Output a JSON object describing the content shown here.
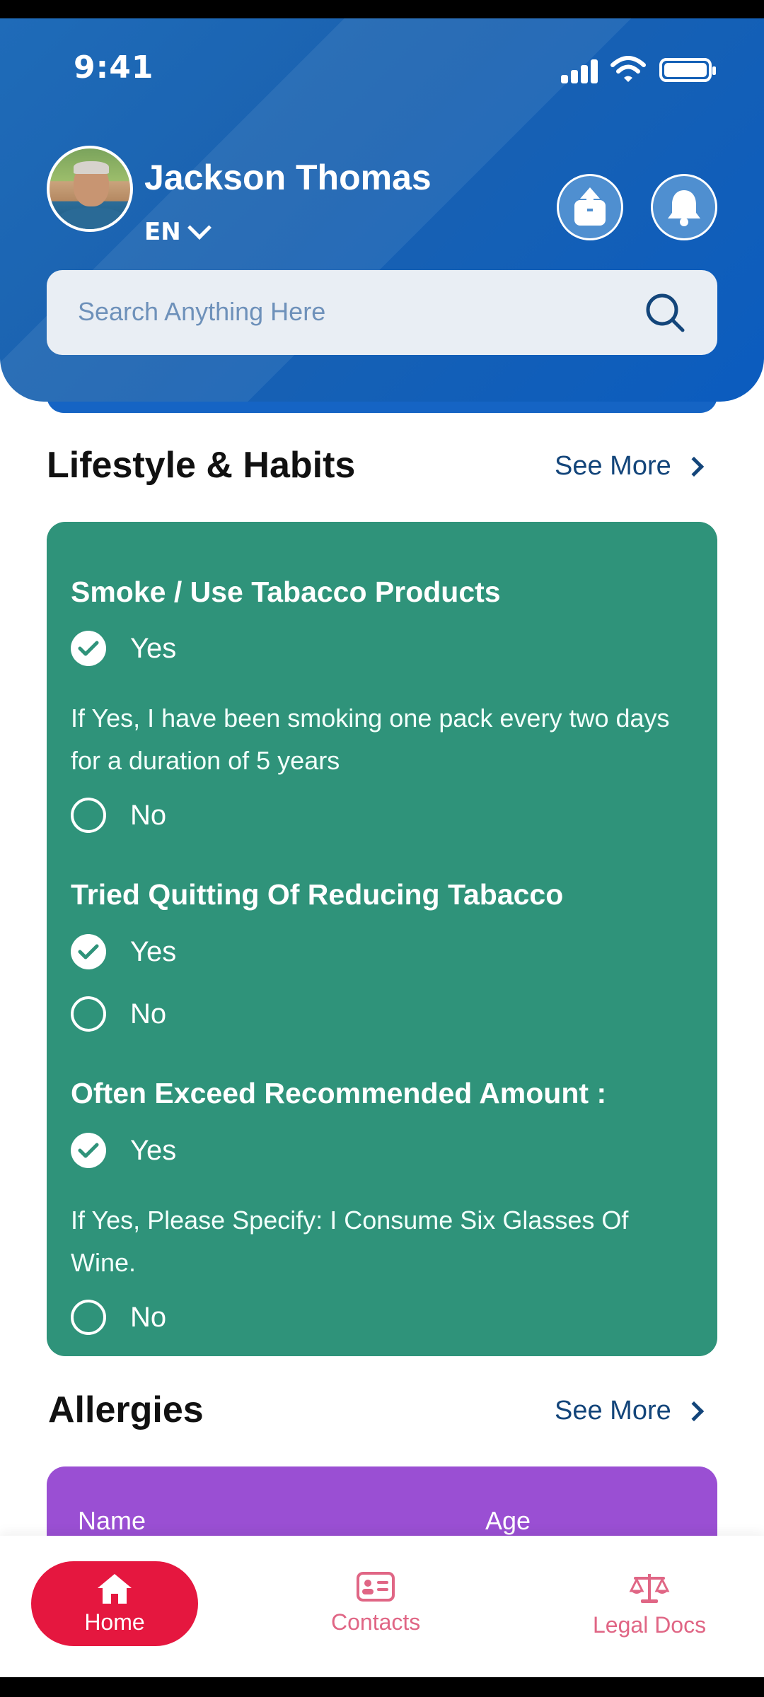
{
  "status_bar": {
    "time": "9:41"
  },
  "header": {
    "user_name": "Jackson Thomas",
    "language": "EN",
    "share_icon": "share-upload-icon",
    "bell_icon": "bell-icon"
  },
  "search": {
    "placeholder": "Search Anything Here"
  },
  "lifestyle": {
    "title": "Lifestyle & Habits",
    "see_more": "See More",
    "q1": {
      "question": "Smoke / Use Tabacco Products",
      "yes": "Yes",
      "note": "If Yes, I have been smoking one pack every two days for a duration of 5 years",
      "no": "No",
      "selected": "Yes"
    },
    "q2": {
      "question": "Tried Quitting Of Reducing Tabacco",
      "yes": "Yes",
      "no": "No",
      "selected": "Yes"
    },
    "q3": {
      "question": "Often Exceed Recommended Amount :",
      "yes": "Yes",
      "note": "If Yes, Please Specify: I Consume Six Glasses Of Wine.",
      "no": "No",
      "selected": "Yes"
    }
  },
  "allergies": {
    "title": "Allergies",
    "see_more": "See More",
    "columns": [
      "Name",
      "Age"
    ]
  },
  "bottom_nav": {
    "home": "Home",
    "contacts": "Contacts",
    "legal_docs": "Legal Docs"
  },
  "colors": {
    "header_blue": "#1a62b0",
    "card_green": "#2f937a",
    "card_purple": "#9a4fd3",
    "nav_active": "#e5173f",
    "nav_inactive": "#e06685"
  }
}
